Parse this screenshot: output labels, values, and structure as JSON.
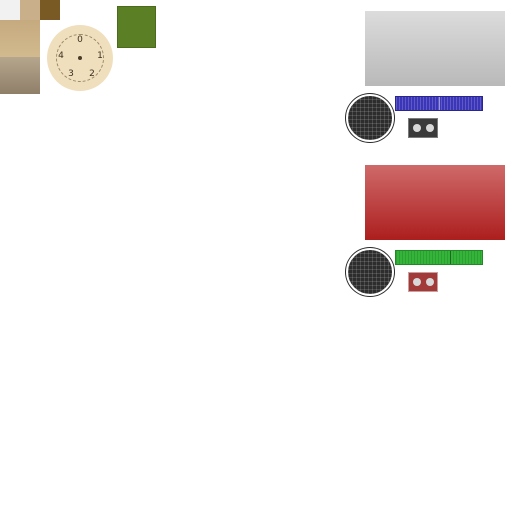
{
  "dial": {
    "numbers": [
      "0",
      "1",
      "2",
      "3",
      "4"
    ]
  },
  "colors": {
    "green_swatch": "#5a7f24",
    "gray_panel": "#c8c8c8",
    "red_panel": "#b82a2a",
    "blue_strip": "#3b35b8",
    "green_strip": "#34b53a"
  },
  "icons": {
    "speaker_grille": "speaker-grille-icon",
    "led_strip": "led-strip-icon",
    "socket_module": "socket-module-icon"
  }
}
